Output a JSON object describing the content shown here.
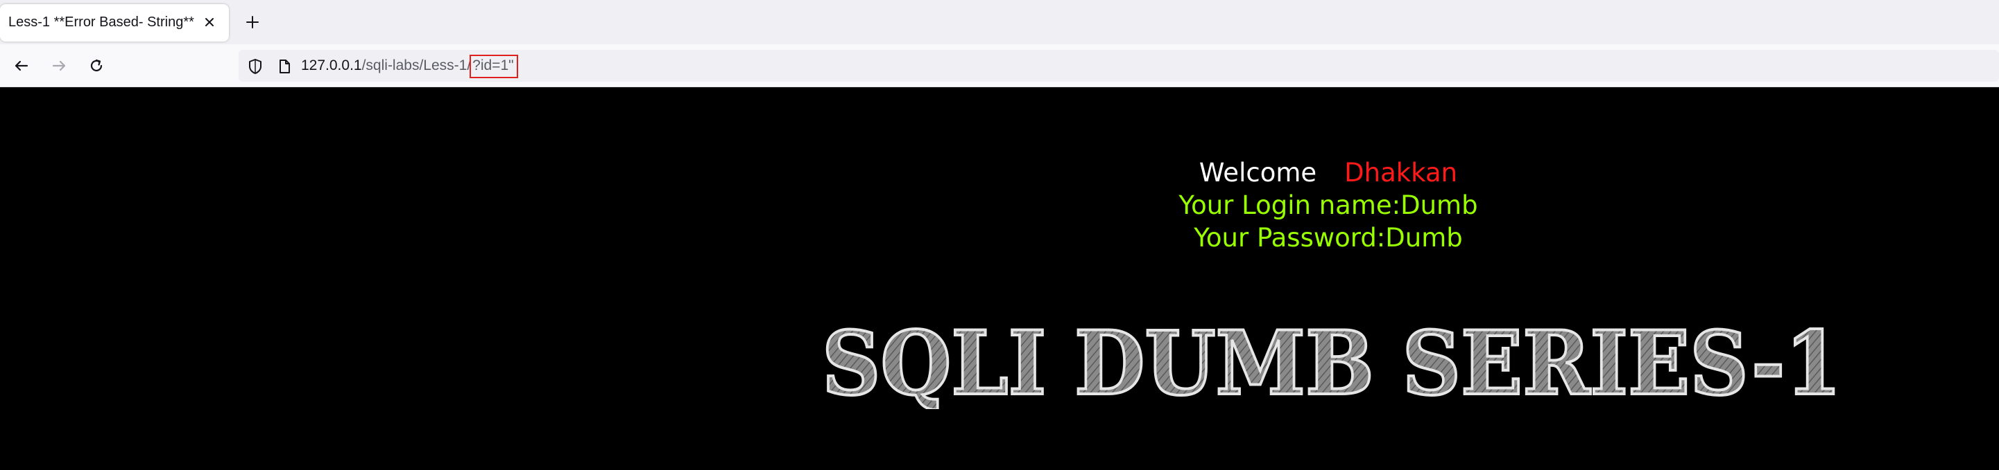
{
  "browser": {
    "tab": {
      "title": "Less-1 **Error Based- String**"
    },
    "url": {
      "host": "127.0.0.1",
      "path": "/sqli-labs/Less-1/",
      "query": "?id=1\""
    }
  },
  "page": {
    "welcome": "Welcome",
    "welcome_name": "Dhakkan",
    "login_line": "Your Login name:Dumb",
    "password_line": "Your Password:Dumb",
    "banner_text": "SQLI DUMB SERIES-1"
  },
  "colors": {
    "page_bg": "#000000",
    "welcome": "#ffffff",
    "name": "#ff1a1a",
    "info_green": "#99ff00",
    "url_highlight_box": "#e0201c"
  }
}
